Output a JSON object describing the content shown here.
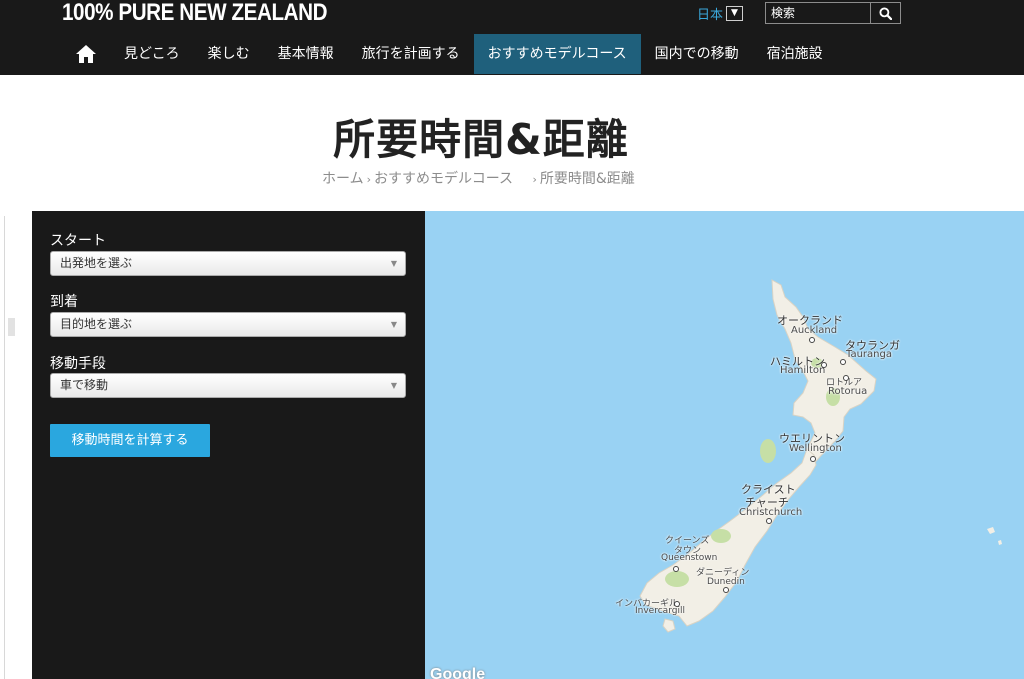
{
  "header": {
    "logo": "100% PURE NEW ZEALAND",
    "language": "日本",
    "search_placeholder": "検索",
    "icons": {
      "home": "home-icon",
      "search": "search-icon",
      "caret": "chevron-down-icon"
    }
  },
  "nav": {
    "items": [
      {
        "label": "見どころ",
        "active": false
      },
      {
        "label": "楽しむ",
        "active": false
      },
      {
        "label": "基本情報",
        "active": false
      },
      {
        "label": "旅行を計画する",
        "active": false
      },
      {
        "label": "おすすめモデルコース",
        "active": true
      },
      {
        "label": "国内での移動",
        "active": false
      },
      {
        "label": "宿泊施設",
        "active": false
      }
    ]
  },
  "page": {
    "title": "所要時間&距離",
    "breadcrumb": [
      "ホーム",
      "おすすめモデルコース",
      "所要時間&距離"
    ],
    "breadcrumb_sep": "›"
  },
  "form": {
    "start_label": "スタート",
    "start_value": "出発地を選ぶ",
    "end_label": "到着",
    "end_value": "目的地を選ぶ",
    "mode_label": "移動手段",
    "mode_value": "車で移動",
    "submit_label": "移動時間を計算する"
  },
  "map": {
    "attribution": "Google",
    "cities": {
      "auckland_jp": "オークランド",
      "auckland_en": "Auckland",
      "tauranga_jp": "タウランガ",
      "tauranga_en": "Tauranga",
      "hamilton_jp": "ハミルトン",
      "hamilton_en": "Hamilton",
      "rotorua_jp": "ロトルア",
      "rotorua_en": "Rotorua",
      "wellington_jp": "ウエリントン",
      "wellington_en": "Wellington",
      "christchurch_jp1": "クライスト",
      "christchurch_jp2": "チャーチ",
      "christchurch_en": "Christchurch",
      "queenstown_jp1": "クイーンズ",
      "queenstown_jp2": "タウン",
      "queenstown_en": "Queenstown",
      "dunedin_jp": "ダニーディン",
      "dunedin_en": "Dunedin",
      "invercargill_jp": "インバカーギル",
      "invercargill_en": "Invercargill"
    },
    "colors": {
      "sea": "#99d2f3",
      "land": "#f2efe6",
      "park": "#c6dfa6"
    }
  },
  "colors": {
    "topbar": "#191919",
    "nav_active": "#1f607c",
    "accent": "#2aa7df"
  }
}
